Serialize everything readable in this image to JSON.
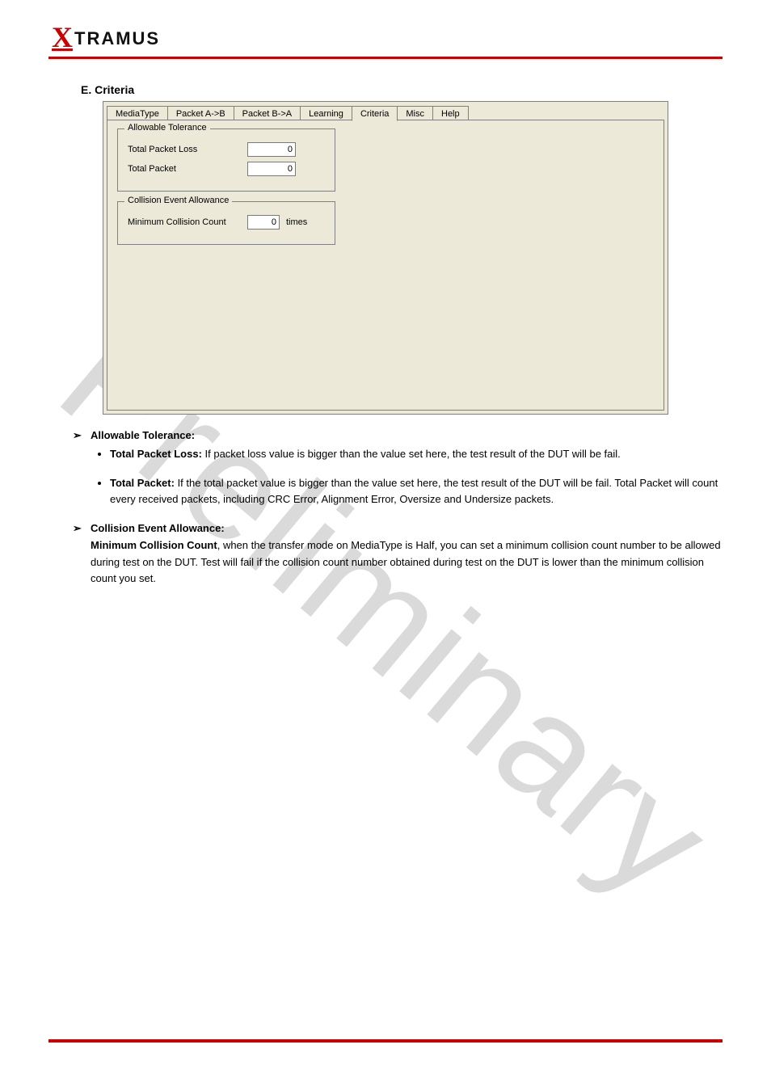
{
  "brand": {
    "x": "X",
    "rest": "TRAMUS"
  },
  "watermark": "Preliminary",
  "heading": "E. Criteria",
  "screenshot": {
    "tabs": [
      "MediaType",
      "Packet A->B",
      "Packet B->A",
      "Learning",
      "Criteria",
      "Misc",
      "Help"
    ],
    "active_tab_index": 4,
    "group1": {
      "title": "Allowable Tolerance",
      "total_packet_loss_label": "Total Packet Loss",
      "total_packet_loss_value": "0",
      "total_packet_label": "Total Packet",
      "total_packet_value": "0"
    },
    "group2": {
      "title": "Collision Event Allowance",
      "min_collision_label": "Minimum Collision Count",
      "min_collision_value": "0",
      "min_collision_unit": "times"
    }
  },
  "bullets": [
    {
      "title": "Allowable Tolerance:",
      "sub": [
        {
          "label": "Total Packet Loss:",
          "desc": "If packet loss value is bigger than the value set here, the test result of the DUT will be fail."
        },
        {
          "label": "Total Packet:",
          "desc": "If the total packet value is bigger than the value set here, the test result of the DUT will be fail. Total Packet will count every received packets, including CRC Error, Alignment Error, Oversize and Undersize packets."
        }
      ]
    },
    {
      "title": "Collision Event Allowance:",
      "sub_inline": {
        "label": "Minimum Collision Count",
        "desc": ", when the transfer mode on MediaType is Half, you can set a minimum collision count number to be allowed during test on the DUT. Test will fail if the collision count number obtained during test on the DUT is lower than the minimum collision count you set."
      }
    }
  ]
}
